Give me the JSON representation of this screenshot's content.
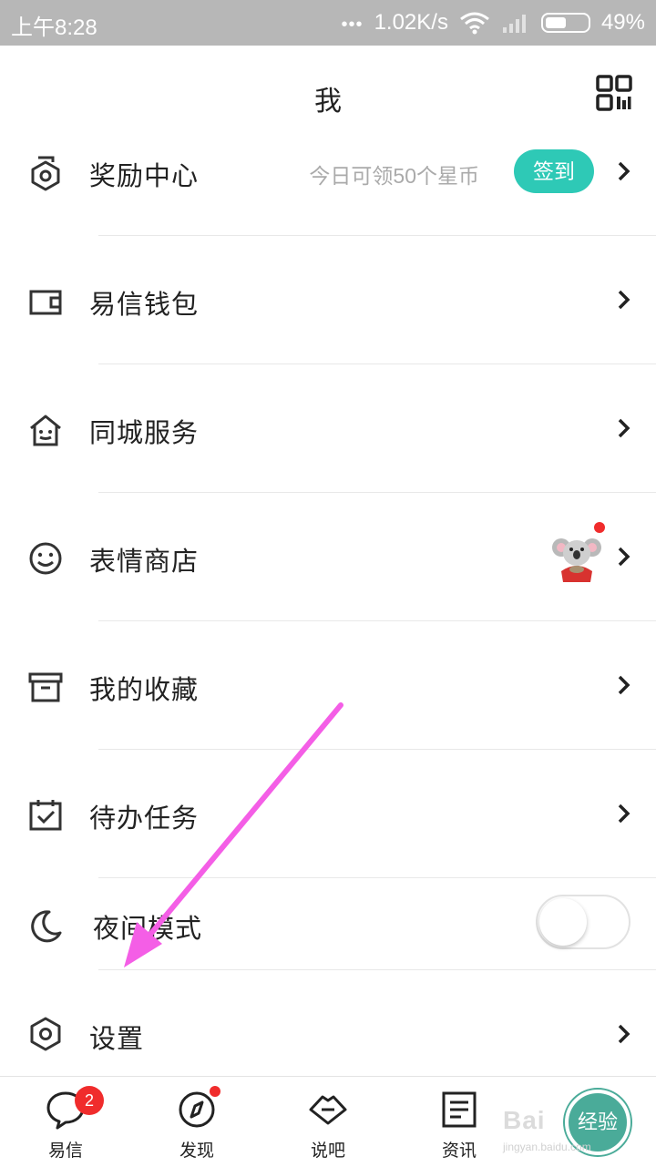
{
  "status_bar": {
    "time": "上午8:28",
    "dots": "•••",
    "speed": "1.02K/s",
    "battery": "49%"
  },
  "header": {
    "title": "我",
    "qr_icon": "qr-code-icon"
  },
  "menu": {
    "reward": {
      "label": "奖励中心",
      "subtitle": "今日可领50个星币",
      "button": "签到",
      "icon": "medal-icon"
    },
    "wallet": {
      "label": "易信钱包",
      "icon": "wallet-icon"
    },
    "local": {
      "label": "同城服务",
      "icon": "house-icon"
    },
    "stickers": {
      "label": "表情商店",
      "icon": "smiley-icon"
    },
    "favorites": {
      "label": "我的收藏",
      "icon": "archive-box-icon"
    },
    "todo": {
      "label": "待办任务",
      "icon": "checkbox-icon"
    },
    "night": {
      "label": "夜间模式",
      "icon": "moon-icon",
      "enabled": false
    },
    "settings": {
      "label": "设置",
      "icon": "hexagon-gear-icon"
    }
  },
  "tabs": [
    {
      "label": "易信",
      "icon": "chat-bubble-icon",
      "badge": "2"
    },
    {
      "label": "发现",
      "icon": "compass-icon"
    },
    {
      "label": "说吧",
      "icon": "lips-icon"
    },
    {
      "label": "资讯",
      "icon": "news-icon"
    }
  ],
  "watermark": {
    "text": "Bai",
    "circle": "经验",
    "sub": "jingyan.baidu.com"
  },
  "colors": {
    "accent": "#2ec9b6",
    "badge": "#f02c2c",
    "arrow": "#f45ee6"
  }
}
